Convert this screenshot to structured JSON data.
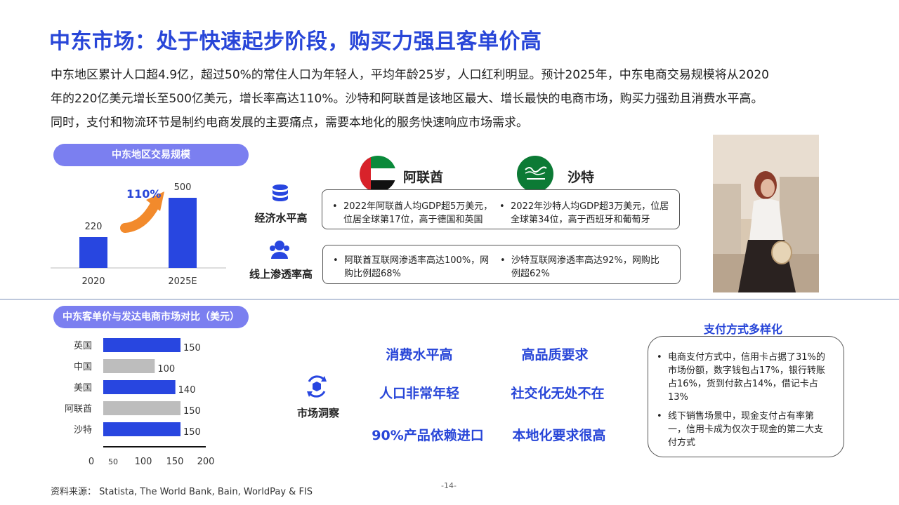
{
  "title": "中东市场：处于快速起步阶段，购买力强且客单价高",
  "intro": [
    "中东地区累计人口超4.9亿，超过50%的常住人口为年轻人，平均年龄25岁，人口红利明显。预计2025年，中东电商交易规模将从2020",
    "年的220亿美元增长至500亿美元，增长率高达110%。沙特和阿联酋是该地区最大、增长最快的电商市场，购买力强劲且消费水平高。",
    "同时，支付和物流环节是制约电商发展的主要痛点，需要本地化的服务快速响应市场需求。"
  ],
  "trade_chart": {
    "pill": "中东地区交易规模",
    "growth_label": "110%",
    "growth_color": "#f28a2c"
  },
  "chart_data": [
    {
      "type": "bar",
      "title": "中东地区交易规模",
      "categories": [
        "2020",
        "2025E"
      ],
      "values": [
        220,
        500
      ],
      "value_labels": [
        "220",
        "500"
      ],
      "color": "#2846e0"
    },
    {
      "type": "bar",
      "orientation": "horizontal",
      "title": "中东客单价与发达电商市场对比（美元）",
      "categories": [
        "英国",
        "中国",
        "美国",
        "阿联酋",
        "沙特"
      ],
      "values": [
        150,
        100,
        140,
        150,
        150
      ],
      "value_labels": [
        "150",
        "100",
        "140",
        "150",
        "150"
      ],
      "bar_colors": [
        "#2846e0",
        "#bdbdbd",
        "#2846e0",
        "#bdbdbd",
        "#2846e0"
      ],
      "xticks": [
        "0",
        "50",
        "100",
        "150",
        "200"
      ],
      "xlim": [
        0,
        200
      ]
    }
  ],
  "countries": {
    "uae": {
      "name": "阿联酋",
      "flag_icon": "uae-flag-icon"
    },
    "ksa": {
      "name": "沙特",
      "flag_icon": "saudi-flag-icon"
    }
  },
  "rows": [
    {
      "label": "经济水平高",
      "icon": "database-icon",
      "uae": "2022年阿联酋人均GDP超5万美元，位居全球第17位，高于德国和英国",
      "ksa": "2022年沙特人均GDP超3万美元，位居全球第34位，高于西班牙和葡萄牙"
    },
    {
      "label": "线上渗透率高",
      "icon": "users-icon",
      "uae": "阿联酋互联网渗透率高达100%，网购比例超68%",
      "ksa": "沙特互联网渗透率高达92%，网购比例超62%"
    }
  ],
  "avg_price": {
    "pill": "中东客单价与发达电商市场对比（美元）"
  },
  "insights": {
    "label": "市场洞察",
    "icon": "refresh-box-icon",
    "items": [
      "消费水平高",
      "高品质要求",
      "人口非常年轻",
      "社交化无处不在",
      "90%产品依赖进口",
      "本地化要求很高"
    ]
  },
  "payment": {
    "title": "支付方式多样化",
    "items": [
      "电商支付方式中，信用卡占据了31%的市场份额，数字钱包占17%，银行转账占16%，货到付款占14%，借记卡占13%",
      "线下销售场景中，现金支付占有率第一，信用卡成为仅次于现金的第二大支付方式"
    ]
  },
  "source": "资料来源：  Statista, The World Bank, Bain, WorldPay & FIS",
  "page_number": "-14-",
  "accent": "#2846d8"
}
